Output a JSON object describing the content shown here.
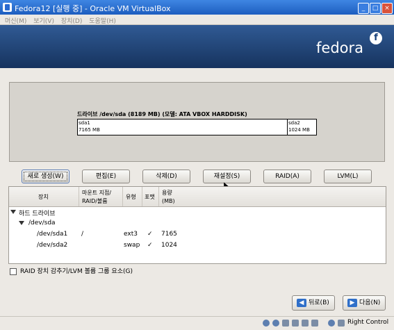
{
  "window": {
    "title": "Fedora12 [실행 중] - Oracle VM VirtualBox",
    "controls": [
      "_",
      "□",
      "×"
    ]
  },
  "menu": [
    "머신(M)",
    "보기(V)",
    "장치(D)",
    "도움말(H)"
  ],
  "banner": {
    "logo_text": "fedora",
    "logo_mark": "f"
  },
  "disk": {
    "label": "드라이브 /dev/sda (8189 MB) (모델: ATA VBOX HARDDISK)",
    "partitions": [
      {
        "name": "sda1",
        "size": "7165 MB"
      },
      {
        "name": "sda2",
        "size": "1024 MB"
      }
    ]
  },
  "actions": {
    "create": "새로 생성(W)",
    "edit": "편집(E)",
    "delete": "삭제(D)",
    "reset": "재설정(S)",
    "raid": "RAID(A)",
    "lvm": "LVM(L)"
  },
  "table": {
    "headers": {
      "device": "장치",
      "mount_line1": "마운트 지점/",
      "mount_line2": "RAID/볼륨",
      "type": "유형",
      "format": "포맷",
      "size_line1": "용량",
      "size_line2": "(MB)"
    },
    "group": "하드 드라이브",
    "drive": "/dev/sda",
    "rows": [
      {
        "device": "/dev/sda1",
        "mount": "/",
        "type": "ext3",
        "format": "✓",
        "size": "7165"
      },
      {
        "device": "/dev/sda2",
        "mount": "",
        "type": "swap",
        "format": "✓",
        "size": "1024"
      }
    ]
  },
  "hide_raid_lvm": "RAID 장치 감추기/LVM 볼륨 그룹 요소(G)",
  "nav": {
    "back": "뒤로(B)",
    "next": "다음(N)"
  },
  "statusbar": {
    "host_key": "Right Control"
  }
}
